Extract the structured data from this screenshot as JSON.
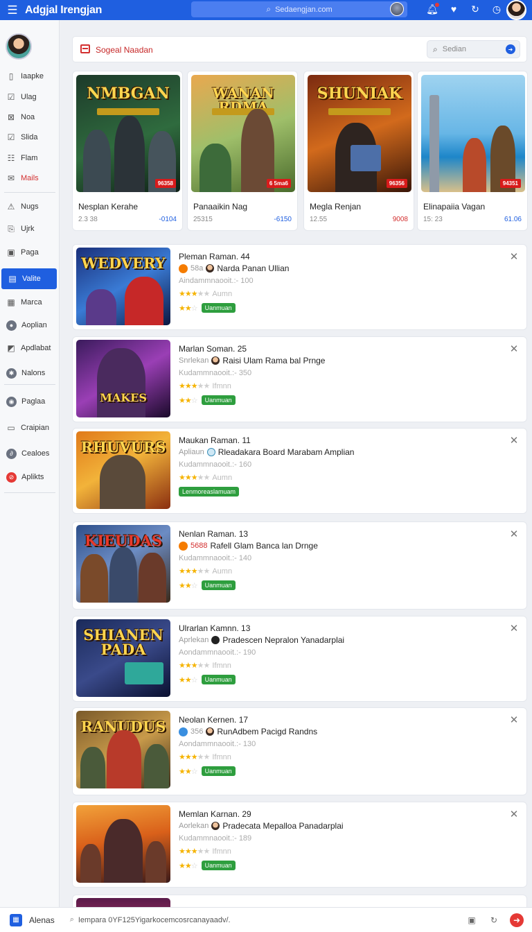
{
  "topbar": {
    "menu_icon": "hamburger-icon",
    "title": "Adgjal Irengjan",
    "search_placeholder": "Sedaengjan.com",
    "icons": [
      "bell-icon",
      "heart-icon",
      "refresh-icon",
      "history-icon"
    ]
  },
  "sidebar": {
    "groups": [
      [
        {
          "label": "Iaapke",
          "icon": "document-icon"
        },
        {
          "label": "Ulag",
          "icon": "checkbox-icon"
        },
        {
          "label": "Noa",
          "icon": "grid-icon"
        },
        {
          "label": "Slida",
          "icon": "checkbox-icon"
        },
        {
          "label": "Flam",
          "icon": "list-icon"
        },
        {
          "label": "Mails",
          "icon": "mail-icon",
          "highlight": true
        }
      ],
      [
        {
          "label": "Nugs",
          "icon": "warning-icon"
        },
        {
          "label": "Ujrk",
          "icon": "bookmark-icon"
        },
        {
          "label": "Paga",
          "icon": "page-icon"
        },
        {
          "label": "Valite",
          "icon": "folder-icon",
          "active": true
        },
        {
          "label": "Marca",
          "icon": "tag-icon"
        },
        {
          "label": "Aoplian",
          "icon": "app-icon"
        },
        {
          "label": "Apdlabat",
          "icon": "edit-icon"
        },
        {
          "label": "Nalons",
          "icon": "settings-icon"
        }
      ],
      [
        {
          "label": "Paglaa",
          "icon": "circle-icon"
        },
        {
          "label": "Craipian",
          "icon": "chat-icon"
        },
        {
          "label": "Cealoes",
          "icon": "link-icon"
        },
        {
          "label": "Aplikts",
          "icon": "apps-icon",
          "red": true
        }
      ]
    ]
  },
  "content_header": {
    "title": "Sogeal Naadan",
    "search_placeholder": "Sedian"
  },
  "featured": [
    {
      "art_title": "NMBGAN",
      "badge": "96358",
      "name": "Nesplan Kerahe",
      "meta": "2.3 38",
      "price": "-0104",
      "price_red": false
    },
    {
      "art_title": "WANAN RDMA",
      "badge": "6 5ma6",
      "name": "Panaaikin Nag",
      "meta": "25315",
      "price": "-6150",
      "price_red": false
    },
    {
      "art_title": "SHUNIAK",
      "badge": "96356",
      "name": "Megla Renjan",
      "meta": "12.55",
      "price": "9008",
      "price_red": true
    },
    {
      "art_title": "",
      "badge": "94351",
      "name": "Elinapaiia Vagan",
      "meta": "15: 23",
      "price": "61.06",
      "price_red": false
    }
  ],
  "list": [
    {
      "art_title": "WEDVERY",
      "title": "Pleman Raman. 44",
      "line2_lead": "58a",
      "line2_desc": "Narda Panan Ullian",
      "line3": "Aindammnaooit.:- 100",
      "stars_tail": "Aumn",
      "tag": "Uanmuan"
    },
    {
      "art_title": "MAKES",
      "title": "Marlan Soman. 25",
      "line2_lead": "Snrlekan",
      "line2_desc": "Raisi Ulam Rama bal Prnge",
      "line3": "Kudammnaooit.:- 350",
      "stars_tail": "Ifmnn",
      "tag": "Uanmuan"
    },
    {
      "art_title": "RHUVURS",
      "title": "Maukan Raman. 11",
      "line2_lead": "Apliaun",
      "line2_desc": "Rleadakara Board Marabam Amplian",
      "line3": "Kudammnaooit.:- 160",
      "stars_tail": "Aumn",
      "tag": "Lenmoreaslamuam"
    },
    {
      "art_title": "KIEUDAS",
      "title": "Nenlan Raman. 13",
      "line2_lead": "5688",
      "line2_desc": "Rafell Glam Banca lan Drnge",
      "line3": "Kudammnaooit.:- 140",
      "stars_tail": "Aumn",
      "tag": "Uanmuan"
    },
    {
      "art_title": "SHIANEN PADA",
      "title": "Ulrarlan Kamnn. 13",
      "line2_lead": "Aprlekan",
      "line2_desc": "Pradescen   Nepralon Yanadarplai",
      "line3": "Aondammnaooit.:- 190",
      "stars_tail": "Ifmnn",
      "tag": "Uanmuan"
    },
    {
      "art_title": "RANUDUS",
      "title": "Neolan Kernen. 17",
      "line2_lead": "356",
      "line2_desc": "RunAdbem Pacigd Randns",
      "line3": "Aondammnaooit.:- 130",
      "stars_tail": "Ifmnn",
      "tag": "Uanmuan"
    },
    {
      "art_title": "",
      "title": "Memlan Karnan. 29",
      "line2_lead": "Aorlekan",
      "line2_desc": "Pradecata  Mepalloa Panadarplai",
      "line3": "Kudammnaooit.:- 189",
      "stars_tail": "Ifmnn",
      "tag": "Uanmuan"
    }
  ],
  "bottombar": {
    "app_name": "Alenas",
    "url": "Iempara 0YF125Yigarkocemcosrcanayaadv/.",
    "icons": [
      "square-icon",
      "refresh-icon",
      "arrow-icon"
    ]
  },
  "colors": {
    "primary": "#1f5fe0",
    "danger": "#d32f2f",
    "success": "#2e9e3e",
    "star": "#f5b301"
  }
}
